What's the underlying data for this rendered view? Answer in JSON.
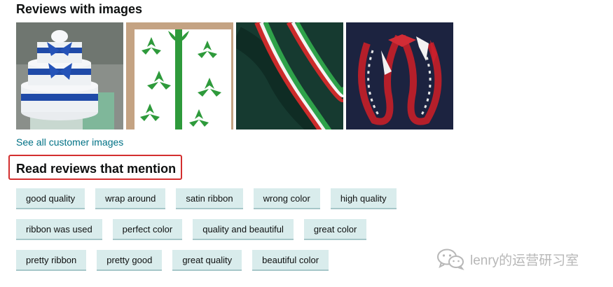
{
  "reviews_with_images": {
    "title": "Reviews with images",
    "images": [
      {
        "name": "review-image-diaper-cake"
      },
      {
        "name": "review-image-green-leaf-box"
      },
      {
        "name": "review-image-ribbon-lei-green"
      },
      {
        "name": "review-image-ribbon-lei-red"
      }
    ],
    "see_all_label": "See all customer images"
  },
  "mentions": {
    "title": "Read reviews that mention",
    "highlight_color": "#d32f2f",
    "rows": [
      [
        "good quality",
        "wrap around",
        "satin ribbon",
        "wrong color",
        "high quality"
      ],
      [
        "ribbon was used",
        "perfect color",
        "quality and beautiful",
        "great color"
      ],
      [
        "pretty ribbon",
        "pretty good",
        "great quality",
        "beautiful color"
      ]
    ]
  },
  "colors": {
    "link": "#007185",
    "chip_bg": "#d9ecec",
    "chip_border": "#a6c7c9"
  },
  "watermark": {
    "text": "lenry的运营研习室",
    "icon": "wechat-icon"
  }
}
